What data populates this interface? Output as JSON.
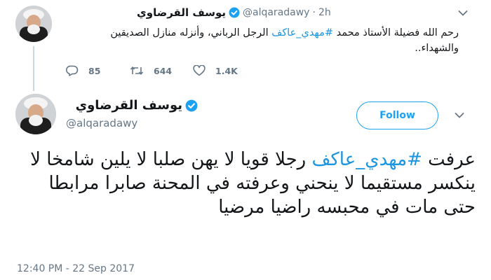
{
  "reply_tweet": {
    "author_name": "يوسف القرضاوي",
    "handle": "@alqaradawy",
    "separator": "·",
    "time_ago": "2h",
    "text_before": "رحم الله فضيلة الأستاذ محمد ",
    "hashtag": "#مهدي_عاكف",
    "text_after": " الرجل الرباني، وأنزله منازل الصديقين والشهداء..",
    "reply_count": "85",
    "retweet_count": "644",
    "like_count": "1.4K"
  },
  "main_tweet": {
    "author_name": "يوسف القرضاوي",
    "handle": "@alqaradawy",
    "follow_label": "Follow",
    "text_before": "عرفت ",
    "hashtag": "#مهدي_عاكف",
    "text_after": " رجلا قويا لا يهن صلبا لا يلين شامخا لا ينكسر مستقيما لا ينحني وعرفته في المحنة صابرا مرابطا حتى مات في محبسه راضيا مرضيا",
    "timestamp": "12:40 PM - 22 Sep 2017"
  },
  "icons": {
    "verified": "verified-badge-icon",
    "reply": "reply-icon",
    "retweet": "retweet-icon",
    "like": "heart-icon",
    "menu": "chevron-down-icon"
  },
  "colors": {
    "link_blue": "#1b95e0",
    "verified_blue": "#1da1f2",
    "muted": "#657786"
  }
}
